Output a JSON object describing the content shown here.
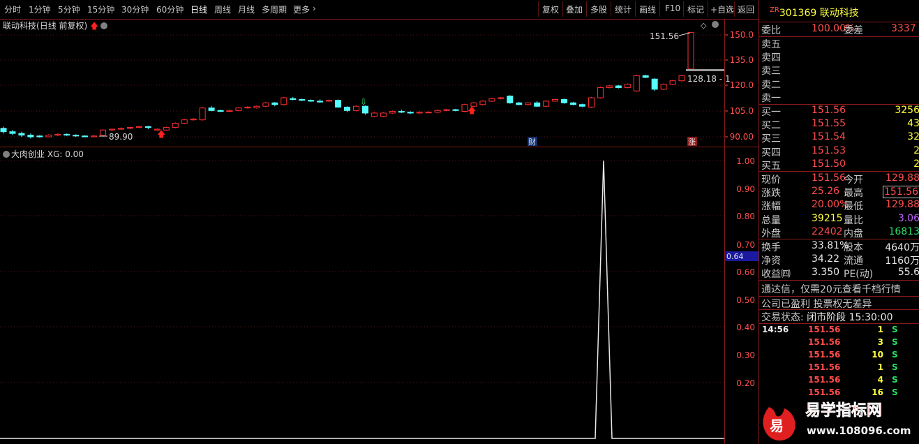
{
  "toolbar": {
    "left_items": [
      "分时",
      "1分钟",
      "5分钟",
      "15分钟",
      "30分钟",
      "60分钟",
      "日线",
      "周线",
      "月线",
      "多周期",
      "更多"
    ],
    "right_items": [
      "复权",
      "叠加",
      "多股",
      "统计",
      "画线",
      "F10",
      "标记",
      "+自选",
      "返回"
    ]
  },
  "main_chart": {
    "stock_name": "联动科技",
    "mode": "(日线 前复权)",
    "y_ticks": [
      "150.0",
      "135.0",
      "120.0",
      "105.0",
      "90.00"
    ],
    "high_label": "151.56",
    "low_label": "89.90",
    "line_label": "128.18 - 1",
    "badge_cai": "财",
    "badge_zhang": "涨",
    "up_color": "#ff3030",
    "down_color": "#54ffff"
  },
  "sub_chart": {
    "indicator_name": "大肉创业",
    "indicator_value": "XG: 0.00",
    "y_ticks": [
      "1.00",
      "0.90",
      "0.80",
      "0.70",
      "0.60",
      "0.50",
      "0.40",
      "0.30",
      "0.20"
    ],
    "cursor_value": "0.64"
  },
  "quote": {
    "code_prefix": "ZR",
    "code": "301369",
    "name": "联动科技",
    "weibi_label": "委比",
    "weibi_value": "100.00%",
    "weicha_label": "委差",
    "weicha_value": "3337",
    "sell": [
      {
        "label": "卖五",
        "price": "",
        "vol": ""
      },
      {
        "label": "卖四",
        "price": "",
        "vol": ""
      },
      {
        "label": "卖三",
        "price": "",
        "vol": ""
      },
      {
        "label": "卖二",
        "price": "",
        "vol": ""
      },
      {
        "label": "卖一",
        "price": "",
        "vol": ""
      }
    ],
    "buy": [
      {
        "label": "买一",
        "price": "151.56",
        "vol": "3256"
      },
      {
        "label": "买二",
        "price": "151.55",
        "vol": "43"
      },
      {
        "label": "买三",
        "price": "151.54",
        "vol": "32"
      },
      {
        "label": "买四",
        "price": "151.53",
        "vol": "2"
      },
      {
        "label": "买五",
        "price": "151.50",
        "vol": "2"
      }
    ],
    "stats1": [
      {
        "l1": "现价",
        "v1": "151.56",
        "l2": "今开",
        "v2": "129.88"
      },
      {
        "l1": "涨跌",
        "v1": "25.26",
        "l2": "最高",
        "v2": "151.56"
      },
      {
        "l1": "涨幅",
        "v1": "20.00%",
        "l2": "最低",
        "v2": "129.88"
      },
      {
        "l1": "总量",
        "v1": "39215",
        "l2": "量比",
        "v2": "3.06"
      },
      {
        "l1": "外盘",
        "v1": "22402",
        "l2": "内盘",
        "v2": "16813"
      }
    ],
    "stats2": [
      {
        "l1": "换手",
        "v1": "33.81%",
        "l2": "股本",
        "v2": "4640万"
      },
      {
        "l1": "净资",
        "v1": "34.22",
        "l2": "流通",
        "v2": "1160万"
      },
      {
        "l1": "收益㈣",
        "v1": "3.350",
        "l2": "PE(动)",
        "v2": "55.6"
      }
    ],
    "ad_line1": "通达信，仅需20元查看千档行情",
    "ad_line2": "公司已盈利 投票权无差异",
    "trade_status_label": "交易状态:",
    "trade_status_value": "闭市阶段 15:30:00",
    "ticks": [
      {
        "time": "14:56",
        "price": "151.56",
        "vol": "1",
        "side": "S"
      },
      {
        "time": "",
        "price": "151.56",
        "vol": "3",
        "side": "S"
      },
      {
        "time": "",
        "price": "151.56",
        "vol": "10",
        "side": "S"
      },
      {
        "time": "",
        "price": "151.56",
        "vol": "1",
        "side": "S"
      },
      {
        "time": "",
        "price": "151.56",
        "vol": "4",
        "side": "S"
      },
      {
        "time": "",
        "price": "151.56",
        "vol": "16",
        "side": "S"
      }
    ]
  },
  "watermark": {
    "logo_char": "易",
    "title": "易学指标网",
    "url": "www.108096.com"
  }
}
